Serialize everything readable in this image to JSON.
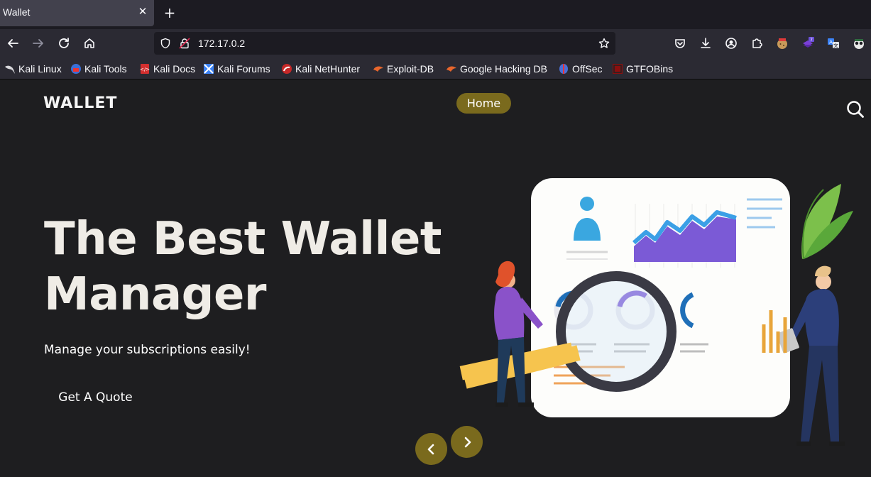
{
  "browser": {
    "tab_title": "Wallet",
    "url": "172.17.0.2",
    "bookmarks": [
      {
        "label": "Kali Linux",
        "icon": "kali-dragon-icon"
      },
      {
        "label": "Kali Tools",
        "icon": "kali-tools-icon"
      },
      {
        "label": "Kali Docs",
        "icon": "kali-docs-icon"
      },
      {
        "label": "Kali Forums",
        "icon": "kali-forums-icon"
      },
      {
        "label": "Kali NetHunter",
        "icon": "nethunter-icon"
      },
      {
        "label": "Exploit-DB",
        "icon": "exploit-db-icon"
      },
      {
        "label": "Google Hacking DB",
        "icon": "ghdb-icon"
      },
      {
        "label": "OffSec",
        "icon": "offsec-icon"
      },
      {
        "label": "GTFOBins",
        "icon": "gtfobins-icon"
      }
    ],
    "extension_badge": "7"
  },
  "site": {
    "brand": "WALLET",
    "nav_home": "Home",
    "headline_line1": "The Best Wallet",
    "headline_line2": "Manager",
    "subtitle": "Manage your subscriptions easily!",
    "cta": "Get A Quote",
    "accent_color": "#7a6a1d"
  }
}
